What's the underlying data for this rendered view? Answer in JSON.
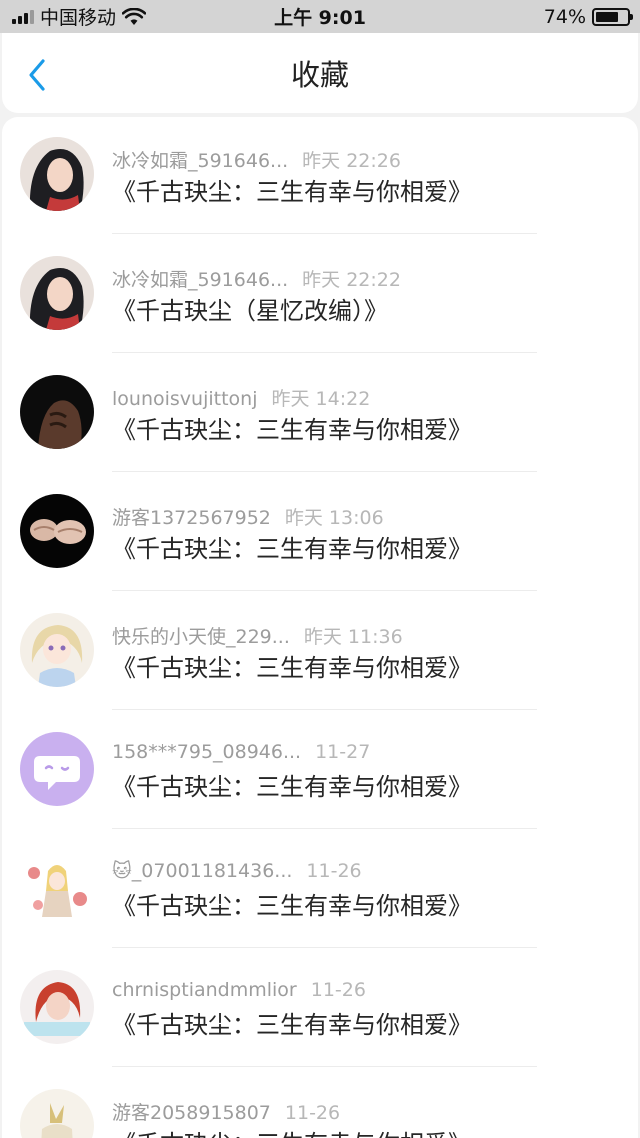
{
  "status_bar": {
    "carrier": "中国移动",
    "time": "上午 9:01",
    "battery_text": "74%",
    "battery_level": 0.74
  },
  "header": {
    "title": "收藏",
    "back_icon": "chevron-left-icon"
  },
  "colors": {
    "accent": "#1a9be8",
    "meta_text": "#9c9c9c",
    "time_text": "#b7b7b7"
  },
  "favorites": [
    {
      "user": "冰冷如霜_591646...",
      "time": "昨天 22:26",
      "title": "《千古玦尘：三生有幸与你相爱》"
    },
    {
      "user": "冰冷如霜_591646...",
      "time": "昨天 22:22",
      "title": "《千古玦尘（星忆改编）》"
    },
    {
      "user": "lounoisvujittonj",
      "time": "昨天 14:22",
      "title": "《千古玦尘：三生有幸与你相爱》"
    },
    {
      "user": "游客1372567952",
      "time": "昨天 13:06",
      "title": "《千古玦尘：三生有幸与你相爱》"
    },
    {
      "user": "快乐的小天使_229...",
      "time": "昨天 11:36",
      "title": "《千古玦尘：三生有幸与你相爱》"
    },
    {
      "user": "158***795_08946...",
      "time": "11-27",
      "title": "《千古玦尘：三生有幸与你相爱》"
    },
    {
      "user": "🐱_07001181436...",
      "time": "11-26",
      "title": "《千古玦尘：三生有幸与你相爱》"
    },
    {
      "user": "chrnisptiandmmlior",
      "time": "11-26",
      "title": "《千古玦尘：三生有幸与你相爱》"
    },
    {
      "user": "游客2058915807",
      "time": "11-26",
      "title": "《千古玦尘：三生有幸与你相爱》"
    }
  ]
}
